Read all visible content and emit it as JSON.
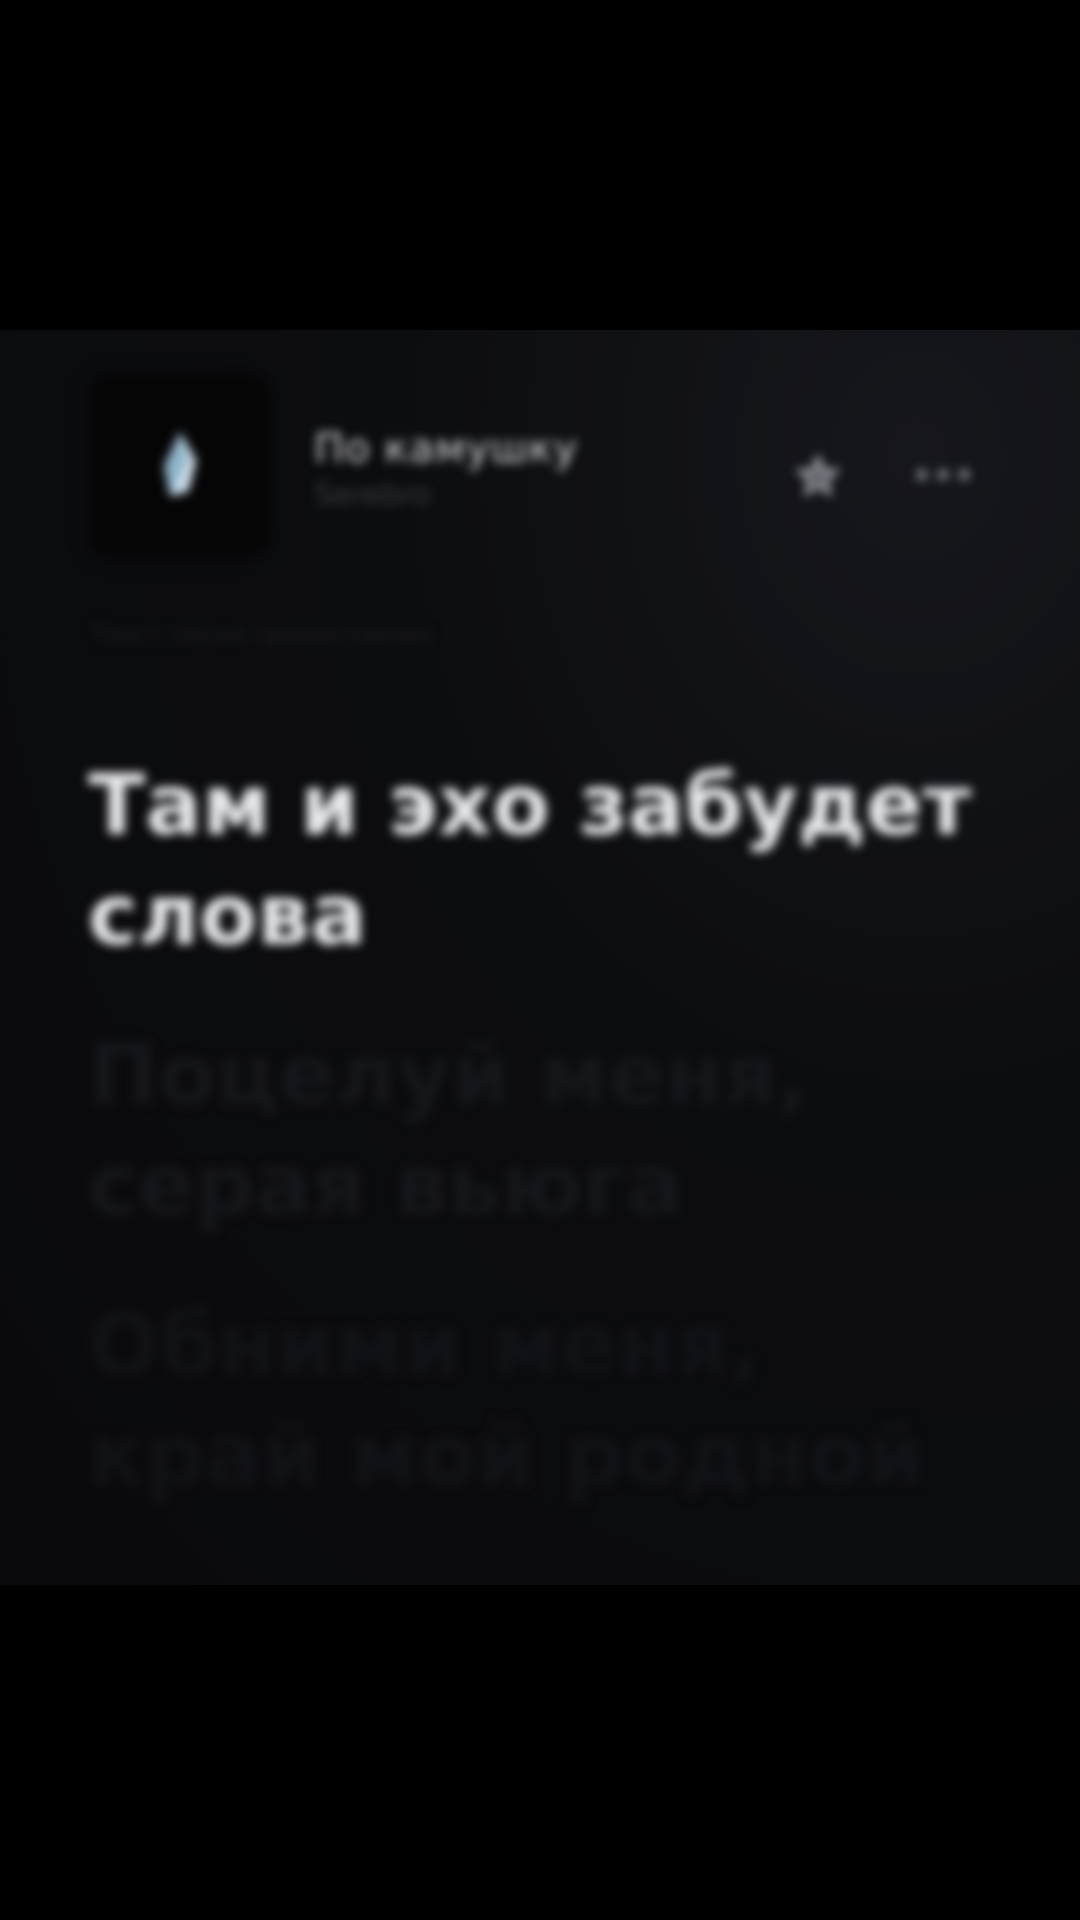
{
  "track": {
    "title": "По камушку",
    "artist": "Serebro",
    "cover_icon": "crystal-icon"
  },
  "actions": {
    "favorite_icon": "star-icon",
    "more_icon": "more-dots-icon",
    "more_label": "•••"
  },
  "lyrics": {
    "source": "Текст песни предоставлен",
    "lines": [
      "Там и эхо забудет слова",
      "Поцелуй меня, серая вьюга",
      "Обними меня, край мой родной"
    ]
  },
  "colors": {
    "background": "#000000",
    "card": "#0c0d10",
    "active_text": "#e8e9ec",
    "dim_text": "#16171b"
  }
}
